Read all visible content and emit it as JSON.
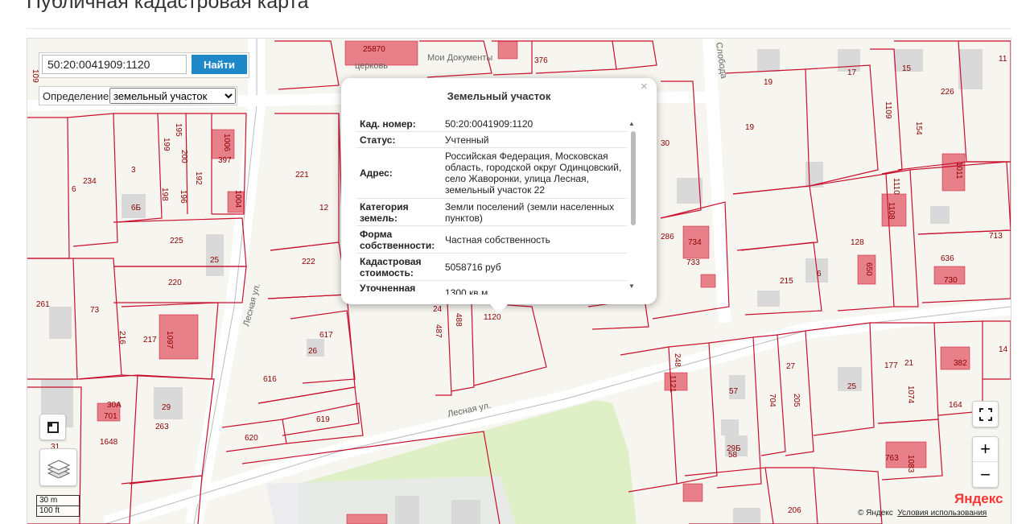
{
  "page": {
    "title": "Публичная кадастровая карта"
  },
  "search": {
    "value": "50:20:0041909:1120",
    "button_label": "Найти"
  },
  "definition": {
    "label": "Определение:",
    "selected": "земельный участок"
  },
  "popup": {
    "title": "Земельный участок",
    "close": "×",
    "rows": [
      {
        "key": "Кад. номер:",
        "value": "50:20:0041909:1120"
      },
      {
        "key": "Статус:",
        "value": "Учтенный"
      },
      {
        "key": "Адрес:",
        "value": "Российская Федерация, Московская область, городской округ Одинцовский, село Жаворонки, улица Лесная, земельный участок 22"
      },
      {
        "key": "Категория земель:",
        "value": "Земли поселений (земли населенных пунктов)"
      },
      {
        "key": "Форма собственности:",
        "value": "Частная собственность"
      },
      {
        "key": "Кадастровая стоимость:",
        "value": "5058716 руб"
      },
      {
        "key": "Уточненная площадь:",
        "value": "1300 кв.м"
      }
    ]
  },
  "map": {
    "parcel_labels": [
      "25870",
      "376",
      "19",
      "17",
      "15",
      "11",
      "226",
      "109",
      "154",
      "1110",
      "1108",
      "228",
      "1011",
      "713",
      "6",
      "234",
      "3",
      "199",
      "196",
      "198",
      "200",
      "192",
      "397",
      "1004",
      "221",
      "12",
      "225",
      "25",
      "222",
      "220",
      "30",
      "286",
      "734",
      "733",
      "128",
      "636",
      "730",
      "650",
      "215",
      "73",
      "217",
      "1097",
      "616",
      "617",
      "26",
      "261",
      "216",
      "487",
      "488",
      "1120",
      "24",
      "248",
      "1121",
      "57",
      "704",
      "205",
      "27",
      "25",
      "177",
      "1074",
      "382",
      "164",
      "14",
      "701",
      "29",
      "263",
      "1648",
      "31",
      "620",
      "619",
      "29Б",
      "58",
      "763",
      "1083",
      "206",
      "6Б",
      "50",
      "95",
      "79"
    ],
    "street_labels": [
      "Лесная ул.",
      "Лесная ул.",
      "Слобода"
    ],
    "poi_labels": [
      "Мои Документы",
      "церковь"
    ]
  },
  "controls": {
    "fullscreen_icon": "fullscreen-icon",
    "zoom_in": "+",
    "zoom_out": "−",
    "ruler_icon": "ruler-icon",
    "layers_icon": "layers-icon"
  },
  "scale": {
    "metric": "30 m",
    "imperial": "100 ft"
  },
  "attribution": {
    "copyright": "© Яндекс",
    "terms": "Условия использования",
    "logo": "Яндекс"
  },
  "colors": {
    "parcel_border": "#c8102e",
    "building": "#e8808a",
    "map_bg": "#f7f5ef",
    "park": "#dff0c7",
    "button": "#1e88c9"
  }
}
